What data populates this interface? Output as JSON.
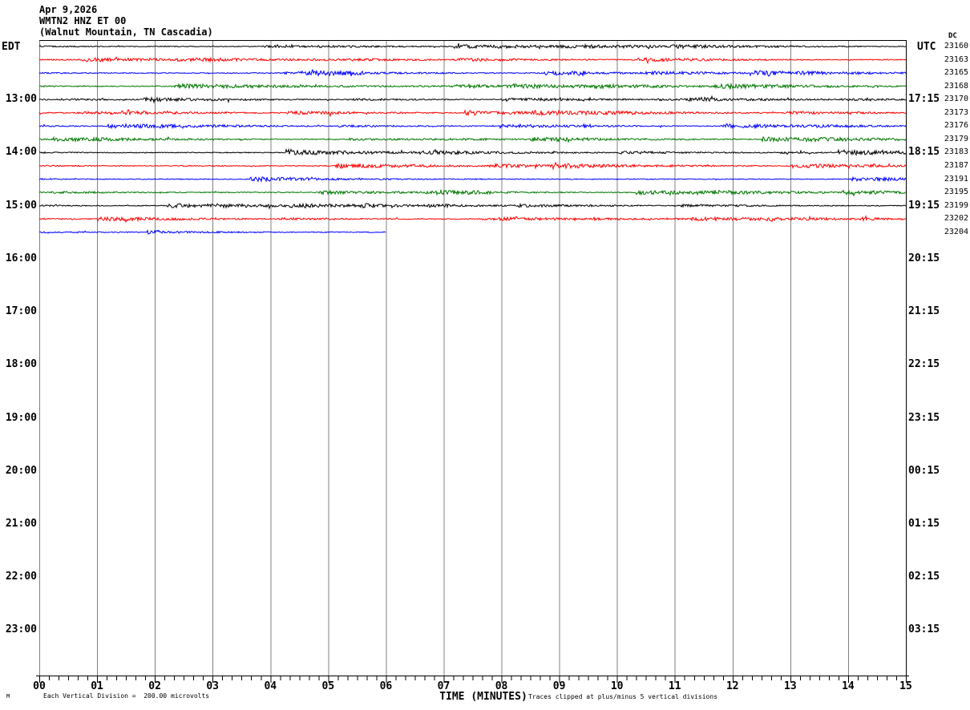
{
  "header": {
    "date": "Apr 9,2026",
    "station": "WMTN2 HNZ ET 00",
    "location": "(Walnut Mountain, TN Cascadia)"
  },
  "left_axis_timezone": "EDT",
  "right_axis_timezone": "UTC",
  "dc_column_header": "DC",
  "footer": {
    "scale_note": "Each Vertical Division =  200.00 microvolts",
    "clip_note": "Traces clipped at plus/minus 5 vertical divisions",
    "corner_mark": "M"
  },
  "colors": {
    "black": "#000000",
    "red": "#ff0000",
    "blue": "#0000ff",
    "green": "#007700",
    "grid": "#808080",
    "frame": "#000000"
  },
  "chart_data": {
    "type": "line",
    "description": "Helicorder-style seismogram: 15 rows of continuous seismic noise, one row per 15 minutes, clipped amplitude; waveform is random background noise with small bursts.",
    "xlabel": "TIME (MINUTES)",
    "x_range_minutes": [
      0,
      15
    ],
    "x_tick_labels": [
      "00",
      "01",
      "02",
      "03",
      "04",
      "05",
      "06",
      "07",
      "08",
      "09",
      "10",
      "11",
      "12",
      "13",
      "14",
      "15"
    ],
    "minor_ticks_per_minute": 6,
    "left_hour_labels": [
      "13:00",
      "14:00",
      "15:00",
      "16:00",
      "17:00",
      "18:00",
      "19:00",
      "20:00",
      "21:00",
      "22:00",
      "23:00"
    ],
    "right_hour_labels": [
      "17:15",
      "18:15",
      "19:15",
      "20:15",
      "21:15",
      "22:15",
      "23:15",
      "00:15",
      "01:15",
      "02:15",
      "03:15"
    ],
    "rows_per_hour_label": 4,
    "rows": [
      {
        "index": 0,
        "color": "black",
        "dc": "23160",
        "start_minute": 0,
        "end_minute": 15
      },
      {
        "index": 1,
        "color": "red",
        "dc": "23163",
        "start_minute": 0,
        "end_minute": 15
      },
      {
        "index": 2,
        "color": "blue",
        "dc": "23165",
        "start_minute": 0,
        "end_minute": 15
      },
      {
        "index": 3,
        "color": "green",
        "dc": "23168",
        "start_minute": 0,
        "end_minute": 15
      },
      {
        "index": 4,
        "color": "black",
        "dc": "23170",
        "start_minute": 0,
        "end_minute": 15
      },
      {
        "index": 5,
        "color": "red",
        "dc": "23173",
        "start_minute": 0,
        "end_minute": 15
      },
      {
        "index": 6,
        "color": "blue",
        "dc": "23176",
        "start_minute": 0,
        "end_minute": 15
      },
      {
        "index": 7,
        "color": "green",
        "dc": "23179",
        "start_minute": 0,
        "end_minute": 15
      },
      {
        "index": 8,
        "color": "black",
        "dc": "23183",
        "start_minute": 0,
        "end_minute": 15
      },
      {
        "index": 9,
        "color": "red",
        "dc": "23187",
        "start_minute": 0,
        "end_minute": 15
      },
      {
        "index": 10,
        "color": "blue",
        "dc": "23191",
        "start_minute": 0,
        "end_minute": 15
      },
      {
        "index": 11,
        "color": "green",
        "dc": "23195",
        "start_minute": 0,
        "end_minute": 15
      },
      {
        "index": 12,
        "color": "black",
        "dc": "23199",
        "start_minute": 0,
        "end_minute": 15
      },
      {
        "index": 13,
        "color": "red",
        "dc": "23202",
        "start_minute": 0,
        "end_minute": 15
      },
      {
        "index": 14,
        "color": "blue",
        "dc": "23204",
        "start_minute": 0,
        "end_minute": 6
      }
    ],
    "scale_note": "Each Vertical Division =  200.00 microvolts",
    "clip_note": "Traces clipped at plus/minus 5 vertical divisions",
    "grid": "vertical gridlines at each minute, gray"
  }
}
